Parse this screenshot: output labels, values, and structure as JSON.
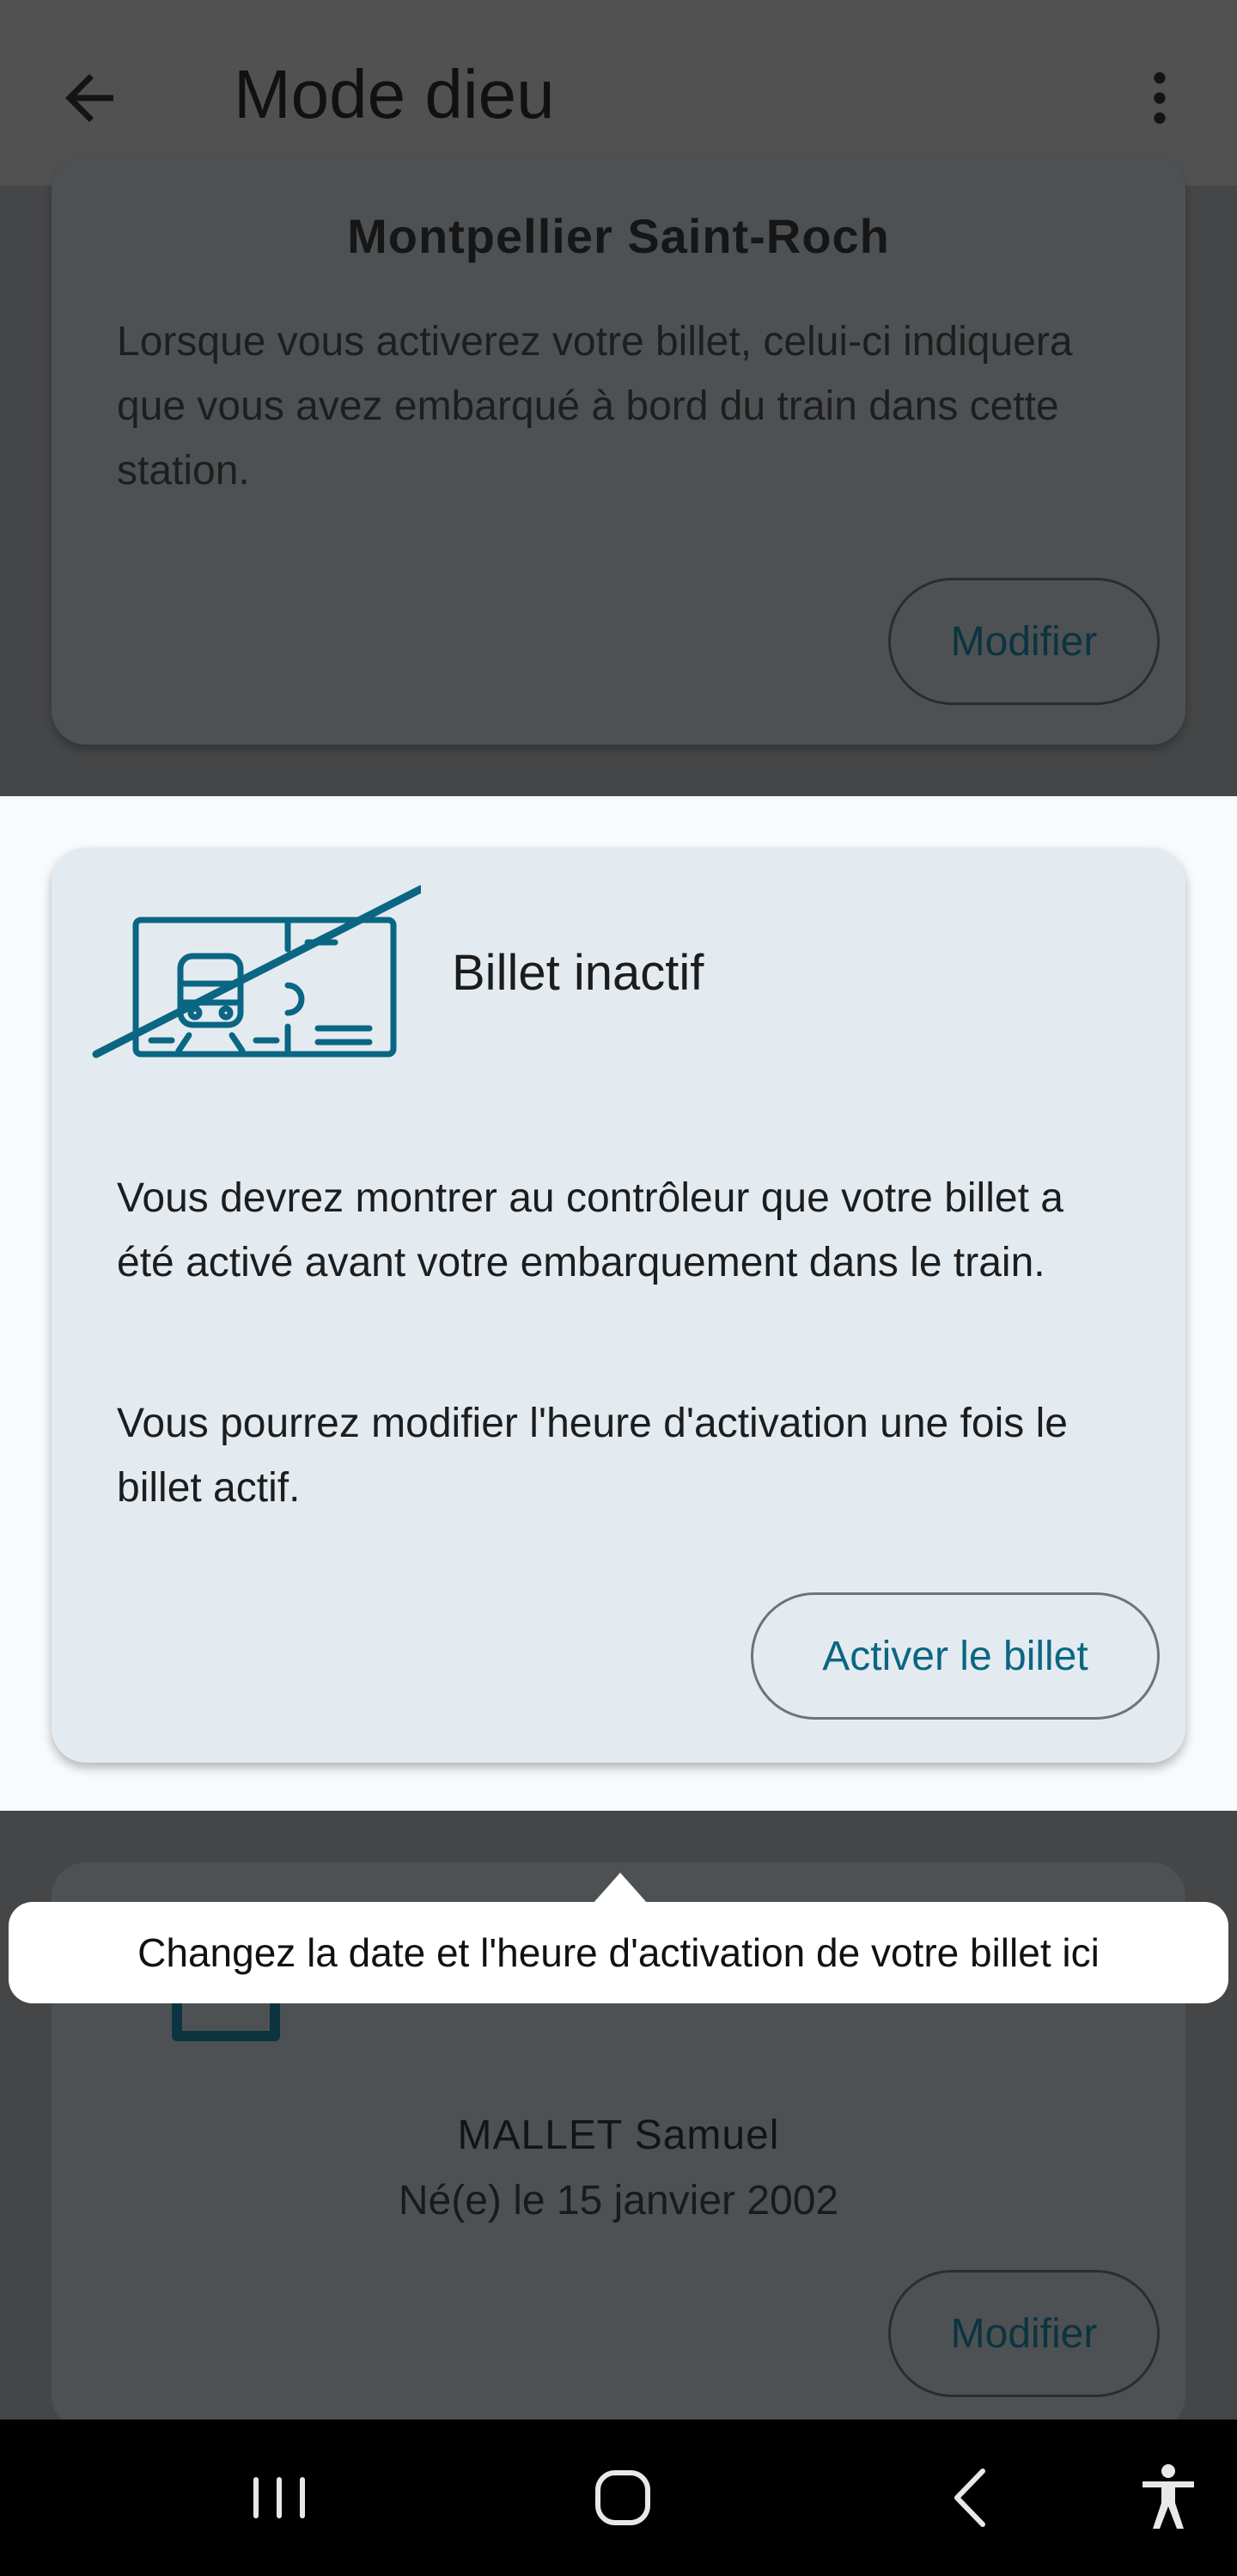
{
  "app_bar": {
    "title": "Mode dieu",
    "back_icon": "arrow-left-icon",
    "menu_icon": "more-vertical-icon"
  },
  "station_card": {
    "station_name": "Montpellier Saint-Roch",
    "description": "Lorsque vous activerez votre billet, celui-ci indiquera que vous avez embarqué à bord du train dans cette station.",
    "button_label": "Modifier"
  },
  "ticket_card": {
    "icon": "inactive-ticket-icon",
    "status": "Billet inactif",
    "paragraph_1": "Vous devrez montrer au contrôleur que votre billet a été activé avant votre embarquement dans le train.",
    "paragraph_2": "Vous pourrez modifier l'heure d'activation une fois le billet actif.",
    "button_label": "Activer le billet"
  },
  "tooltip": {
    "text": "Changez la date et l'heure d'activation de votre billet ici"
  },
  "passenger_card": {
    "icon": "user-card-icon",
    "name": "MALLET Samuel",
    "birth": "Né(e) le 15 janvier 2002",
    "button_label": "Modifier"
  },
  "nav_bar": {
    "icons": [
      "recent-apps-icon",
      "home-icon",
      "back-icon",
      "accessibility-icon"
    ]
  },
  "colors": {
    "accent": "#0a6683",
    "scrim_background": "#454647",
    "card_highlight": "#e4ebf0"
  }
}
